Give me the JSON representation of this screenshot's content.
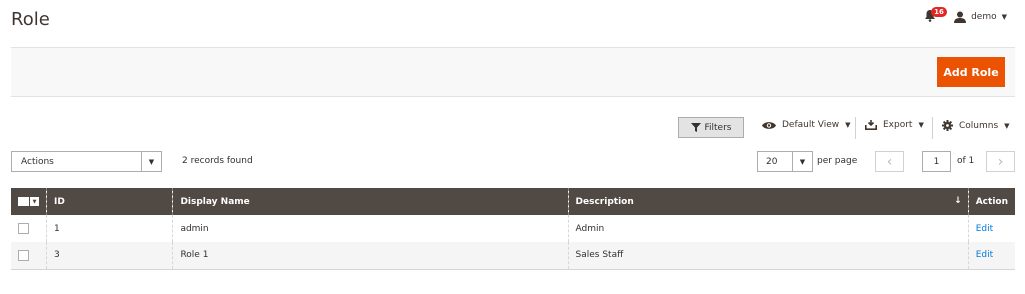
{
  "page": {
    "title": "Role"
  },
  "header": {
    "notifications_count": "16",
    "user_name": "demo"
  },
  "actions": {
    "add_role_label": "Add Role"
  },
  "toolbar": {
    "filters_label": "Filters",
    "default_view_label": "Default View",
    "export_label": "Export",
    "columns_label": "Columns"
  },
  "grid_controls": {
    "mass_actions_label": "Actions",
    "records_found": "2 records found",
    "per_page_value": "20",
    "per_page_label": "per page",
    "current_page": "1",
    "of_pages": "of 1"
  },
  "table": {
    "columns": [
      "ID",
      "Display Name",
      "Description",
      "Action"
    ],
    "rows": [
      {
        "id": "1",
        "display_name": "admin",
        "description": "Admin",
        "action": "Edit"
      },
      {
        "id": "3",
        "display_name": "Role 1",
        "description": "Sales Staff",
        "action": "Edit"
      }
    ],
    "sort_indicator": "↓"
  },
  "colors": {
    "accent": "#eb5202",
    "header_bg": "#514943",
    "link": "#007bdb"
  }
}
